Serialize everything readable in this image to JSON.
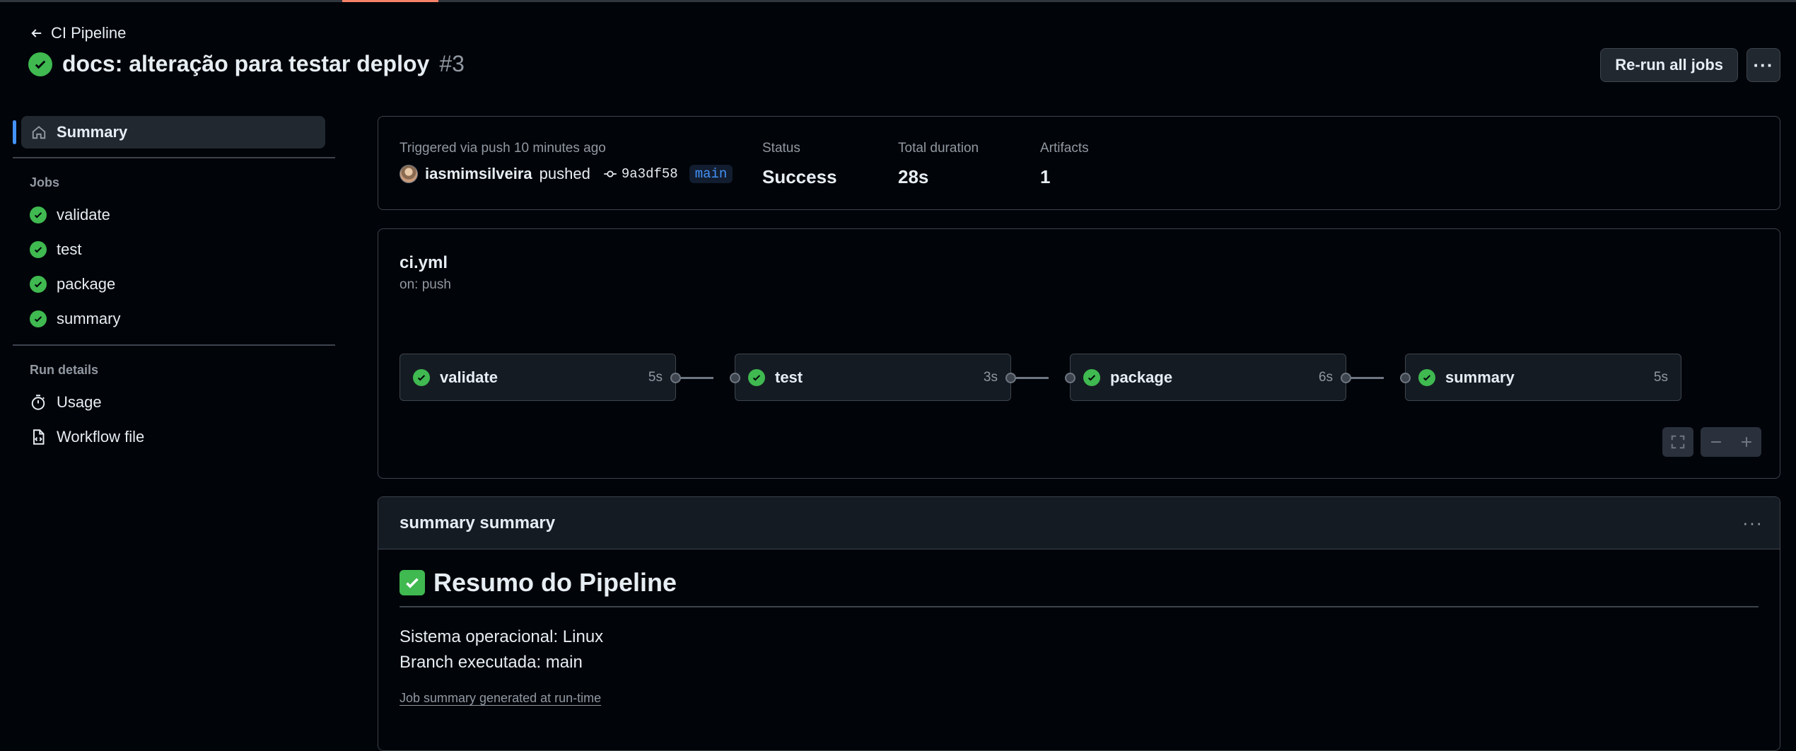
{
  "header": {
    "back_label": "CI Pipeline",
    "run_title": "docs: alteração para testar deploy",
    "run_number": "#3",
    "rerun_label": "Re-run all jobs",
    "more_label": "···"
  },
  "sidebar": {
    "summary_label": "Summary",
    "jobs_heading": "Jobs",
    "jobs": [
      {
        "label": "validate"
      },
      {
        "label": "test"
      },
      {
        "label": "package"
      },
      {
        "label": "summary"
      }
    ],
    "run_details_heading": "Run details",
    "details": [
      {
        "label": "Usage",
        "icon": "stopwatch-icon"
      },
      {
        "label": "Workflow file",
        "icon": "file-code-icon"
      }
    ]
  },
  "run_summary": {
    "trigger_text": "Triggered via push 10 minutes ago",
    "actor": "iasmimsilveira",
    "action": "pushed",
    "commit_sha": "9a3df58",
    "branch": "main",
    "status_label": "Status",
    "status_value": "Success",
    "duration_label": "Total duration",
    "duration_value": "28s",
    "artifacts_label": "Artifacts",
    "artifacts_value": "1"
  },
  "workflow": {
    "file_name": "ci.yml",
    "trigger": "on: push",
    "jobs": [
      {
        "name": "validate",
        "duration": "5s"
      },
      {
        "name": "test",
        "duration": "3s"
      },
      {
        "name": "package",
        "duration": "6s"
      },
      {
        "name": "summary",
        "duration": "5s"
      }
    ]
  },
  "job_summary": {
    "header": "summary summary",
    "more_label": "···",
    "heading": "Resumo do Pipeline",
    "lines": [
      "Sistema operacional: Linux",
      "Branch executada: main"
    ],
    "footer": "Job summary generated at run-time"
  },
  "colors": {
    "background": "#010409",
    "success": "#3fb950",
    "accent": "#4493f8",
    "tab_underline": "#f78166"
  }
}
